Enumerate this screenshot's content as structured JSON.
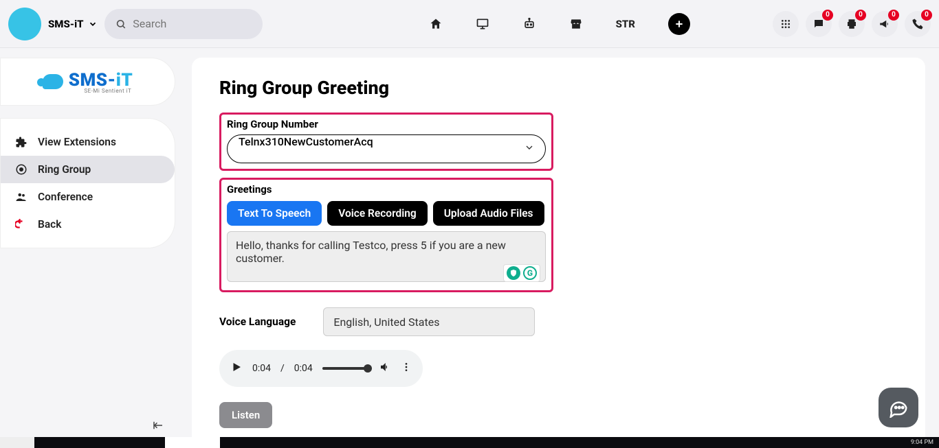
{
  "header": {
    "brand": "SMS-iT",
    "search_placeholder": "Search",
    "str_label": "STR",
    "badge": "0"
  },
  "logo": {
    "title_a": "SMS-",
    "title_b": "iT",
    "subtitle": "SE-Mi Sentient iT"
  },
  "sidebar": {
    "items": [
      {
        "label": "View Extensions"
      },
      {
        "label": "Ring Group"
      },
      {
        "label": "Conference"
      },
      {
        "label": "Back"
      }
    ]
  },
  "page": {
    "title": "Ring Group Greeting",
    "ring_group_label": "Ring Group Number",
    "ring_group_value": "Telnx310NewCustomerAcq",
    "greetings_label": "Greetings",
    "tabs": {
      "tts": "Text To Speech",
      "voice": "Voice Recording",
      "upload": "Upload Audio Files"
    },
    "tts_text": "Hello, thanks for calling Testco, press 5 if you are a new customer.",
    "grammarly_g": "G",
    "voice_lang_label": "Voice Language",
    "voice_lang_value": "English, United States",
    "audio": {
      "current": "0:04",
      "duration": "0:04"
    },
    "listen": "Listen"
  },
  "clock": "9:04 PM"
}
